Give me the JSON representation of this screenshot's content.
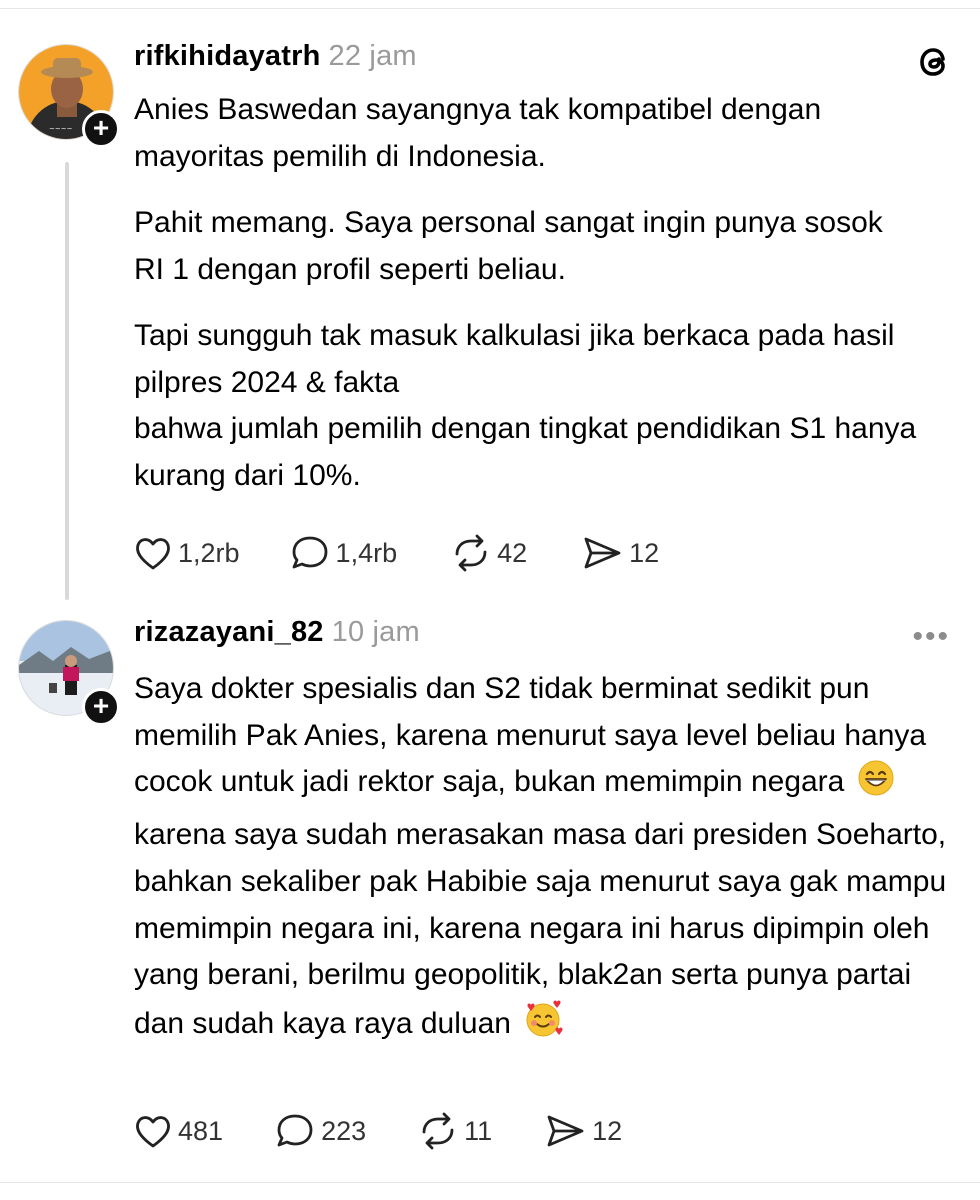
{
  "posts": [
    {
      "username": "rifkihidayatrh",
      "time": "22 jam",
      "paragraphs": [
        "Anies Baswedan sayangnya tak kompatibel dengan mayoritas pemilih di Indonesia.",
        "Pahit memang. Saya personal sangat ingin punya sosok RI 1 dengan profil seperti beliau.",
        "Tapi sungguh tak masuk kalkulasi jika berkaca pada hasil pilpres 2024 & fakta",
        "bahwa jumlah pemilih dengan tingkat pendidikan S1 hanya kurang dari 10%."
      ],
      "likes": "1,2rb",
      "replies": "1,4rb",
      "reposts": "42",
      "shares": "12"
    },
    {
      "username": "rizazayani_82",
      "time": "10 jam",
      "text_part1": "Saya dokter spesialis dan S2 tidak berminat sedikit pun memilih Pak Anies, karena menurut saya level beliau hanya cocok untuk jadi rektor saja, bukan memimpin negara",
      "emoji1": "grinning-face-emoji",
      "text_part2": "karena saya sudah merasakan masa dari presiden Soeharto, bahkan sekaliber pak Habibie saja menurut saya gak mampu memimpin negara ini, karena negara ini harus dipimpin oleh yang berani, berilmu geopolitik, blak2an serta punya partai dan sudah kaya raya duluan",
      "emoji2": "smiling-face-with-hearts-emoji",
      "likes": "481",
      "replies": "223",
      "reposts": "11",
      "shares": "12"
    }
  ],
  "more_menu": "•••",
  "icons": {
    "app": "threads-logo-icon",
    "like": "heart-icon",
    "reply": "comment-icon",
    "repost": "repost-icon",
    "share": "send-icon",
    "follow": "plus-icon"
  }
}
